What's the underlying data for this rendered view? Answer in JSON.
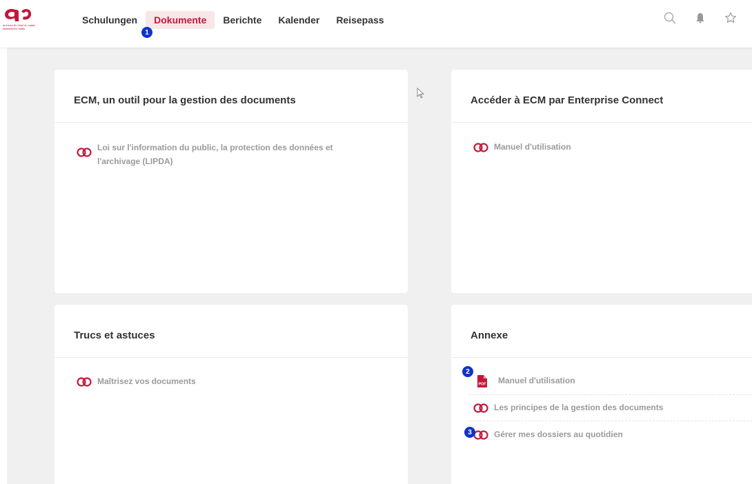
{
  "header": {
    "logo_text_line1": "archives de l'état du valais",
    "logo_text_line2": "staatsarchiv wallis",
    "nav": [
      {
        "label": "Schulungen"
      },
      {
        "label": "Dokumente"
      },
      {
        "label": "Berichte"
      },
      {
        "label": "Kalender"
      },
      {
        "label": "Reisepass"
      }
    ],
    "active_nav": "Dokumente",
    "icons": [
      "search-icon",
      "bell-icon",
      "star-icon"
    ]
  },
  "badges": [
    "1",
    "2",
    "3"
  ],
  "colors": {
    "accent": "#c2173a",
    "badge": "#1034c8",
    "background": "#f0f0f0"
  },
  "cards": [
    {
      "title": "ECM, un outil pour la gestion des documents",
      "links": [
        {
          "line1": "Loi sur l'information du public, la protection des données et",
          "line2": "l'archivage (LIPDA)",
          "icon": "link-icon"
        }
      ]
    },
    {
      "title": "Accéder à ECM par Enterprise Connect",
      "links": [
        {
          "label": "Manuel d'utilisation",
          "icon": "link-icon"
        }
      ]
    },
    {
      "title": "Trucs et astuces",
      "links": [
        {
          "label": "Maîtrisez vos documents",
          "icon": "link-icon"
        }
      ]
    },
    {
      "title": "Annexe",
      "links": [
        {
          "label": "Manuel d'utilisation",
          "icon": "pdf-icon",
          "icon_text": "PDF"
        },
        {
          "label": "Les principes de la gestion des documents",
          "icon": "link-icon"
        },
        {
          "label": "Gérer mes dossiers au quotidien",
          "icon": "link-icon"
        }
      ]
    }
  ]
}
